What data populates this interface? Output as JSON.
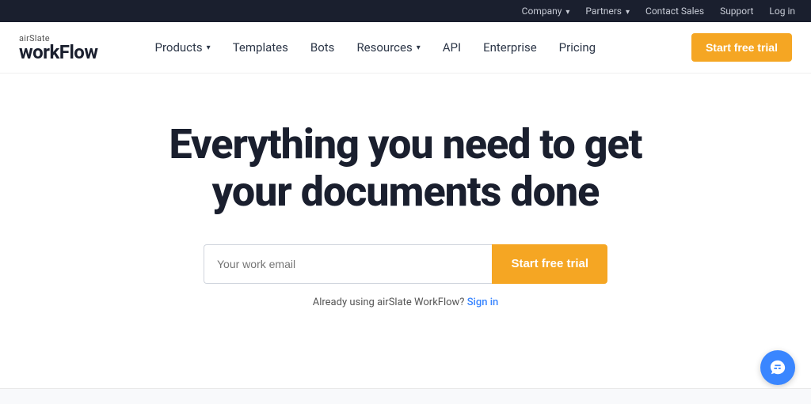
{
  "topbar": {
    "items": [
      {
        "label": "Company",
        "has_chevron": true
      },
      {
        "label": "Partners",
        "has_chevron": true
      },
      {
        "label": "Contact Sales"
      },
      {
        "label": "Support"
      },
      {
        "label": "Log in"
      }
    ]
  },
  "nav": {
    "logo_top": "airSlate",
    "logo_bottom": "workFlow",
    "links": [
      {
        "label": "Products",
        "has_chevron": true
      },
      {
        "label": "Templates",
        "has_chevron": false
      },
      {
        "label": "Bots",
        "has_chevron": false
      },
      {
        "label": "Resources",
        "has_chevron": true
      },
      {
        "label": "API",
        "has_chevron": false
      },
      {
        "label": "Enterprise",
        "has_chevron": false
      },
      {
        "label": "Pricing",
        "has_chevron": false
      }
    ],
    "cta_label": "Start free trial"
  },
  "hero": {
    "title_line1": "Everything you need to get",
    "title_line2": "your documents done",
    "email_placeholder": "Your work email",
    "submit_label": "Start free trial",
    "signin_text": "Already using airSlate WorkFlow?",
    "signin_link": "Sign in"
  },
  "chat": {
    "label": "chat-icon"
  }
}
